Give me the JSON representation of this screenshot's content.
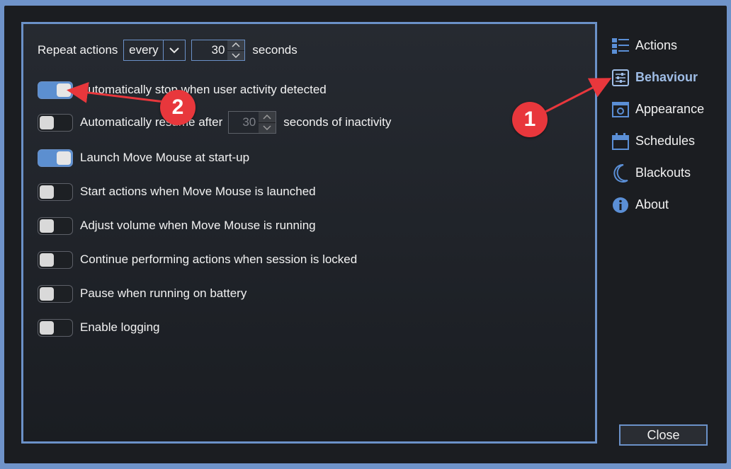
{
  "behaviour": {
    "repeat": {
      "label": "Repeat actions",
      "mode": "every",
      "interval": "30",
      "unit": "seconds"
    },
    "options": [
      {
        "label": "Automatically stop when user activity detected",
        "on": true
      },
      {
        "label_prefix": "Automatically resume after",
        "value": "30",
        "label_suffix": "seconds of inactivity",
        "on": false
      },
      {
        "label": "Launch Move Mouse at start-up",
        "on": true
      },
      {
        "label": "Start actions when Move Mouse is launched",
        "on": false
      },
      {
        "label": "Adjust volume when Move Mouse is running",
        "on": false
      },
      {
        "label": "Continue performing actions when session is locked",
        "on": false
      },
      {
        "label": "Pause when running on battery",
        "on": false
      },
      {
        "label": "Enable logging",
        "on": false
      }
    ]
  },
  "sidebar": {
    "items": [
      {
        "label": "Actions",
        "icon": "list-icon"
      },
      {
        "label": "Behaviour",
        "icon": "sliders-icon",
        "active": true
      },
      {
        "label": "Appearance",
        "icon": "window-icon"
      },
      {
        "label": "Schedules",
        "icon": "calendar-icon"
      },
      {
        "label": "Blackouts",
        "icon": "moon-icon"
      },
      {
        "label": "About",
        "icon": "info-icon"
      }
    ]
  },
  "footer": {
    "close_label": "Close"
  },
  "annotations": {
    "badge1": "1",
    "badge2": "2",
    "color": "#e8373c"
  }
}
